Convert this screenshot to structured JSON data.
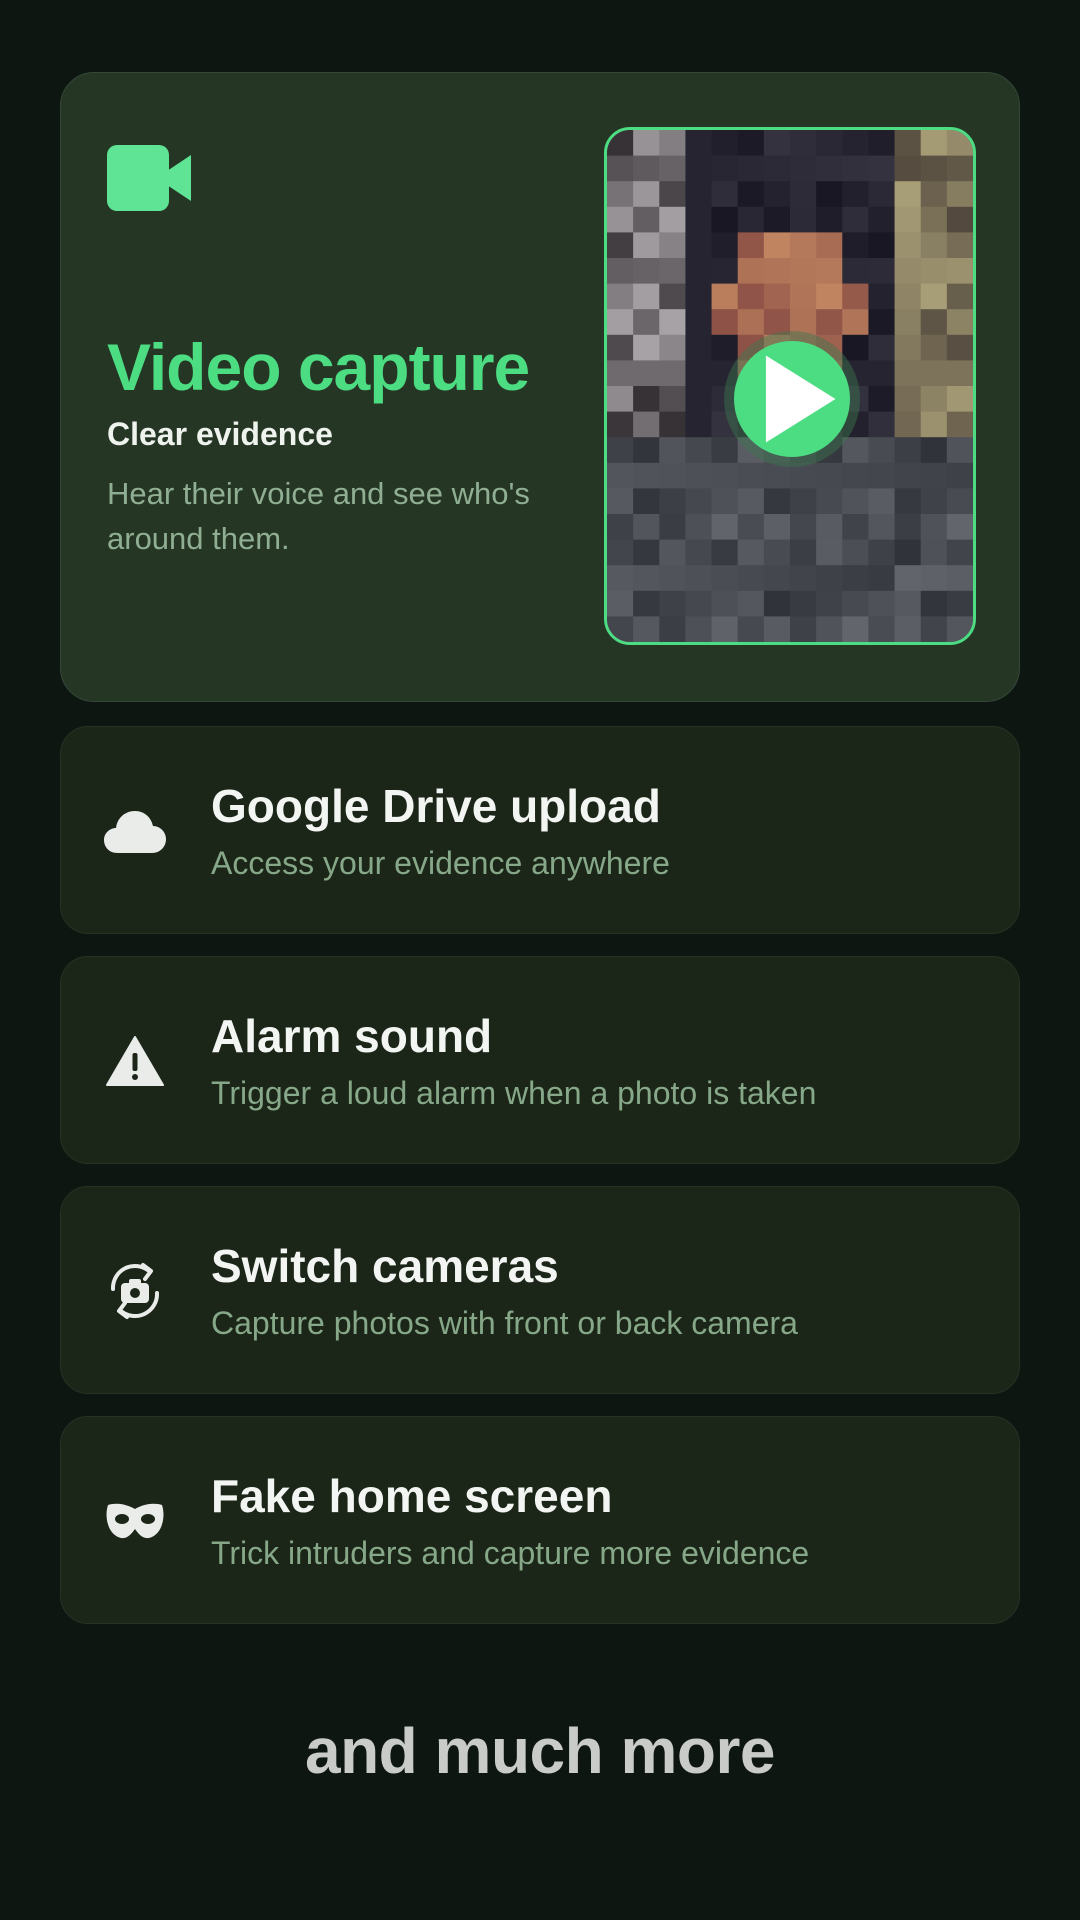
{
  "hero": {
    "title": "Video capture",
    "subtitle": "Clear evidence",
    "description": "Hear their voice and see who's around them.",
    "icon": "video-camera-icon",
    "accent_color": "#4cdc82"
  },
  "features": [
    {
      "title": "Google Drive upload",
      "description": "Access your evidence anywhere",
      "icon": "cloud-icon"
    },
    {
      "title": "Alarm sound",
      "description": "Trigger a loud alarm when a photo is taken",
      "icon": "warning-icon"
    },
    {
      "title": "Switch cameras",
      "description": "Capture photos with front or back camera",
      "icon": "switch-camera-icon"
    },
    {
      "title": "Fake home screen",
      "description": "Trick intruders and capture more evidence",
      "icon": "mask-icon"
    }
  ],
  "footer": {
    "text": "and much more"
  }
}
